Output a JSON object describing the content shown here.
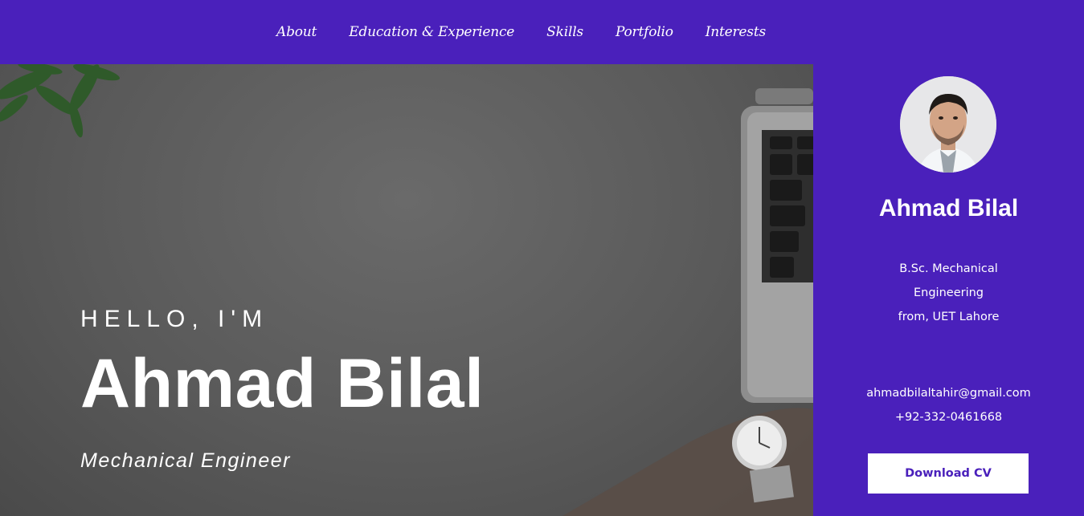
{
  "nav": {
    "items": [
      {
        "label": "About"
      },
      {
        "label": "Education & Experience"
      },
      {
        "label": "Skills"
      },
      {
        "label": "Portfolio"
      },
      {
        "label": "Interests"
      }
    ]
  },
  "hero": {
    "greeting": "HELLO, I'M",
    "name": "Ahmad Bilal",
    "role": "Mechanical Engineer"
  },
  "sidebar": {
    "name": "Ahmad Bilal",
    "education": {
      "line1": "B.Sc. Mechanical",
      "line2": "Engineering",
      "line3": "from, UET Lahore"
    },
    "email": "ahmadbilaltahir@gmail.com",
    "phone": "+92-332-0461668",
    "download_label": "Download CV"
  },
  "colors": {
    "brand": "#4a20bb",
    "white": "#ffffff",
    "overlay": "#5c5c5c"
  }
}
